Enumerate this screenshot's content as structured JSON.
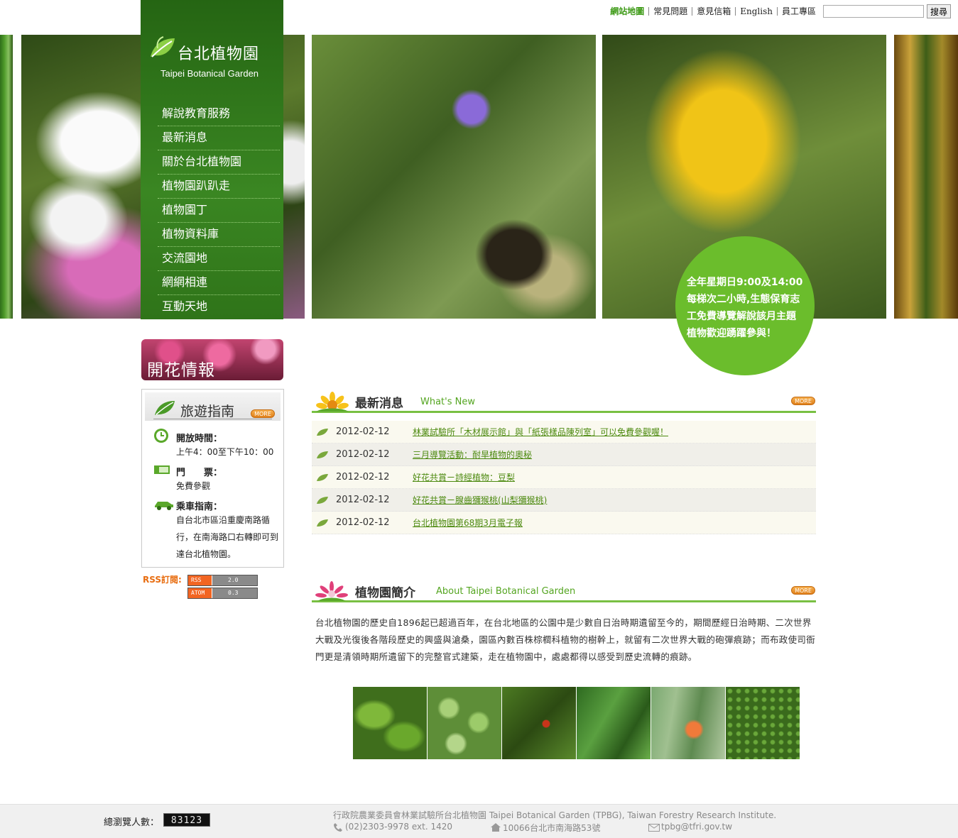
{
  "topbar": {
    "links": [
      "網站地圖",
      "常見問題",
      "意見信箱",
      "English",
      "員工專區"
    ],
    "search_button": "搜尋",
    "search_value": ""
  },
  "logo": {
    "zh": "台北植物園",
    "en": "Taipei Botanical Garden"
  },
  "menu": [
    "解說教育服務",
    "最新消息",
    "關於台北植物園",
    "植物園趴趴走",
    "植物園丁",
    "植物資料庫",
    "交流園地",
    "網網相連",
    "互動天地"
  ],
  "circle": {
    "lines": [
      "全年星期日9:00及14:00",
      "每梯次二小時,生態保育志",
      "工免費導覽解說該月主題",
      "植物歡迎踴躍參與！"
    ]
  },
  "bloom": {
    "title": "開花情報"
  },
  "guide": {
    "title": "旅遊指南",
    "more": "MORE",
    "hours_label": "開放時間：",
    "hours_value": "上午4：00至下午10：00",
    "ticket_label": "門　　票：",
    "ticket_value": "免費參觀",
    "transport_label": "乘車指南：",
    "transport_value": "自台北市區沿重慶南路循行，在南海路口右轉即可到達台北植物園。"
  },
  "rss": {
    "label": "RSS訂閱:",
    "feeds": [
      {
        "a": "RSS",
        "b": "2.0"
      },
      {
        "a": "ATOM",
        "b": "0.3"
      }
    ]
  },
  "news": {
    "title_zh": "最新消息",
    "title_en": "What's New",
    "more": "MORE",
    "items": [
      {
        "date": "2012-02-12",
        "title": "林業試驗所「木材展示館」與「紙張樣品陳列室」可以免費參觀喔！"
      },
      {
        "date": "2012-02-12",
        "title": "三月導覽活動：耐旱植物的奧秘"
      },
      {
        "date": "2012-02-12",
        "title": "好花共賞ㄧ詩經植物：豆梨"
      },
      {
        "date": "2012-02-12",
        "title": "好花共賞ㄧ腺齒獼猴桃(山梨獼猴桃)"
      },
      {
        "date": "2012-02-12",
        "title": "台北植物園第68期3月電子報"
      }
    ]
  },
  "about": {
    "title_zh": "植物園簡介",
    "title_en": "About Taipei Botanical Garden",
    "more": "MORE",
    "text": "台北植物園的歷史自1896起已超過百年，在台北地區的公園中是少數自日治時期遺留至今的，期間歷經日治時期、二次世界大戰及光復後各階段歷史的興盛與滄桑，園區內數百株棕櫚科植物的樹幹上，就留有二次世界大戰的砲彈痕跡；而布政使司衙門更是清領時期所遺留下的完整官式建築，走在植物園中，處處都得以感受到歷史流轉的痕跡。"
  },
  "footer": {
    "counter_label": "總瀏覽人數：",
    "counter": "83123",
    "org": "行政院農業委員會林業試驗所台北植物園 Taipei Botanical Garden (TPBG), Taiwan Forestry Research Institute.",
    "phone": "(02)2303-9978 ext. 1420",
    "address": "10066台北市南海路53號",
    "email": "tpbg@tfri.gov.tw"
  },
  "colors": {
    "nav_green": "#2f7419",
    "accent_green": "#79c043",
    "circle_green": "#6bbd2c",
    "link_green": "#4d8a10",
    "rss_orange": "#f26522"
  }
}
